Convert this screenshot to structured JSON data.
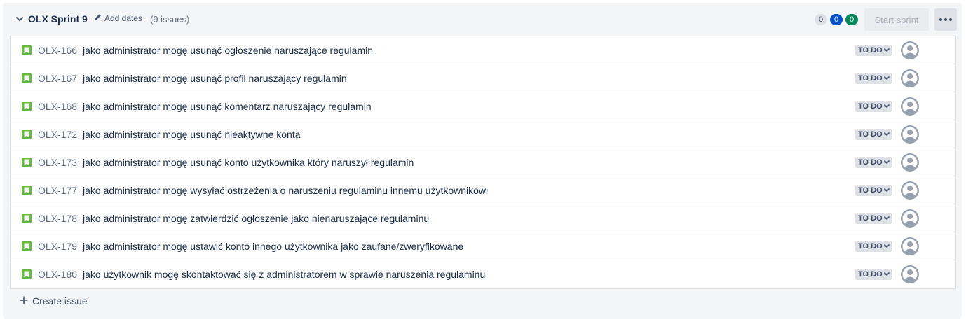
{
  "sprint": {
    "name": "OLX Sprint 9",
    "add_dates_label": "Add dates",
    "issue_count": "(9 issues)",
    "counts": {
      "todo": "0",
      "in_progress": "0",
      "done": "0"
    },
    "start_sprint_label": "Start sprint",
    "colors": {
      "story": "#63ba3c",
      "in_progress": "#0052cc",
      "done": "#00875a"
    }
  },
  "issues": [
    {
      "key": "OLX-166",
      "summary": "jako administrator mogę usunąć ogłoszenie naruszające regulamin",
      "status": "TO DO"
    },
    {
      "key": "OLX-167",
      "summary": "jako administrator mogę usunąć profil naruszający regulamin",
      "status": "TO DO"
    },
    {
      "key": "OLX-168",
      "summary": "jako administrator mogę usunąć komentarz naruszający regulamin",
      "status": "TO DO"
    },
    {
      "key": "OLX-172",
      "summary": "jako administrator mogę usunąć nieaktywne konta",
      "status": "TO DO"
    },
    {
      "key": "OLX-173",
      "summary": "jako administrator mogę usunąć konto użytkownika który naruszył regulamin",
      "status": "TO DO"
    },
    {
      "key": "OLX-177",
      "summary": "jako administrator mogę wysyłać ostrzeżenia o naruszeniu regulaminu innemu użytkownikowi",
      "status": "TO DO"
    },
    {
      "key": "OLX-178",
      "summary": "jako administrator mogę zatwierdzić ogłoszenie jako nienaruszające regulaminu",
      "status": "TO DO"
    },
    {
      "key": "OLX-179",
      "summary": "jako administrator mogę ustawić konto innego użytkownika jako zaufane/zweryfikowane",
      "status": "TO DO"
    },
    {
      "key": "OLX-180",
      "summary": "jako użytkownik mogę skontaktować się z administratorem w sprawie naruszenia regulaminu",
      "status": "TO DO"
    }
  ],
  "footer": {
    "create_issue_label": "Create issue"
  },
  "icons": {
    "collapse": "chevron-down-icon",
    "edit": "pencil-icon",
    "more": "more-icon",
    "issue_type": "story-icon",
    "status_dropdown": "chevron-down-icon",
    "assignee": "avatar-icon",
    "create": "plus-icon"
  }
}
